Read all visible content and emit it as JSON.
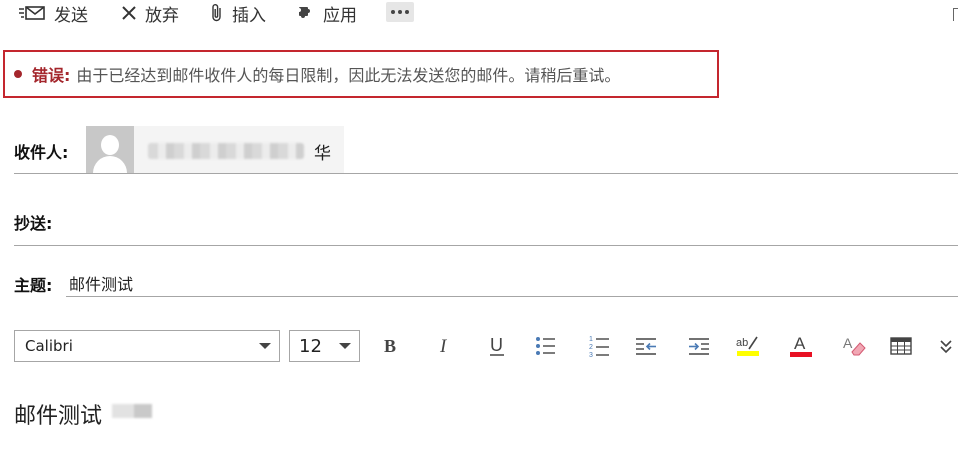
{
  "actions": {
    "send_label": "发送",
    "discard_label": "放弃",
    "insert_label": "插入",
    "apps_label": "应用"
  },
  "error": {
    "label": "错误:",
    "message": "由于已经达到邮件收件人的每日限制，因此无法发送您的邮件。请稍后重试。",
    "color": "#a4262c"
  },
  "fields": {
    "to_label": "收件人:",
    "recipient_name_visible": "华",
    "cc_label": "抄送:",
    "subject_label": "主题:",
    "subject_value": "邮件测试"
  },
  "format_toolbar": {
    "font": "Calibri",
    "size": "12",
    "highlight_color": "#ffff00",
    "font_color": "#e81123",
    "icons": [
      "bold-icon",
      "italic-icon",
      "underline-icon",
      "bullets-icon",
      "numbering-icon",
      "decrease-indent-icon",
      "increase-indent-icon",
      "highlight-icon",
      "font-color-icon",
      "clear-formatting-icon",
      "table-icon",
      "more-chevron-icon"
    ]
  },
  "message_body": {
    "text": "邮件测试"
  }
}
